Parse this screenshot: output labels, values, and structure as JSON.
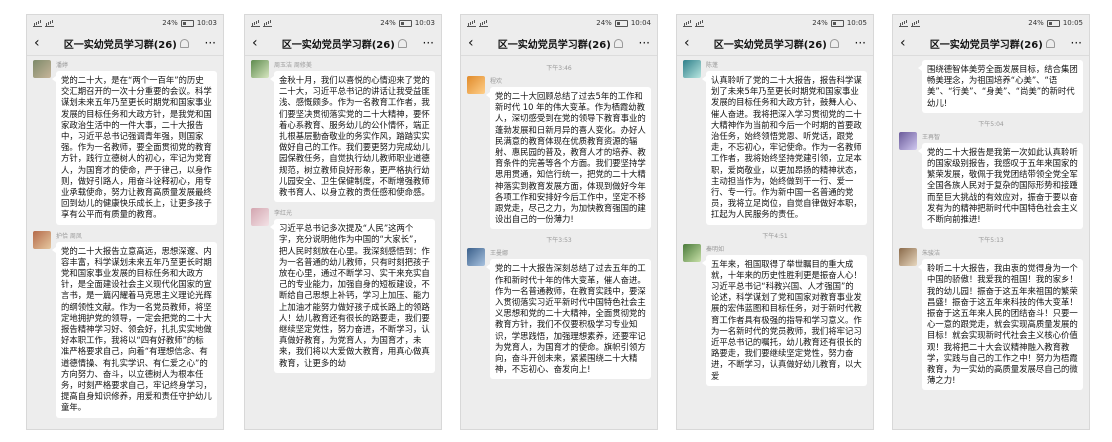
{
  "phones": [
    {
      "status": {
        "time": "10:03",
        "battery": "24%"
      },
      "title": "区一实幼党员学习群(26)",
      "messages": [
        {
          "sender": "潘婷",
          "text": "党的二十大，是在“两个一百年”的历史交汇期召开的一次十分重要的会议。科学谋划未来五年乃至更长时期党和国家事业发展的目标任务和大政方针，是我党和国家政治生活中的一件大事，二十大报告中，习近平总书记强调青年强，则国家强。作为一名教师，要全面贯彻党的教育方针，践行立德树人的初心，牢记为党育人，为国育才的使命，严于律己，以身作则，做好引路人，用奋斗诠释初心，用专业承载使命，努力让教育高质量发展最终回到幼儿的健康快乐成长上，让更多孩子享有公平而有质量的教育。"
        },
        {
          "sender": "护恰 周凤",
          "text": "党的二十大报告立意高远，思想深邃、内容丰富，科学谋划未来五年乃至更长时期党和国家事业发展的目标任务和大政方针，是全面建设社会主义现代化国家的宣言书，是一篇闪耀着马克思主义理论光辉的纲领性文献。作为一名党员教师，将坚定地拥护党的领导，一定会把党的二十大报告精神学习好、领会好，扎扎实实地做好本职工作，我将以“四有好教师”的标准严格要求自己，向着“有理想信念、有道德情操、有扎实学识、有仁爱之心”的方向努力、奋斗，以立德树人为根本任务，时刻严格要求自己，牢记终身学习，提高自身知识修养，用爱和责任守护幼儿童年。"
        }
      ]
    },
    {
      "status": {
        "time": "10:03",
        "battery": "24%"
      },
      "title": "区一实幼党员学习群(26)",
      "messages": [
        {
          "sender": "周玉洁 周修美",
          "text": "金秋十月，我们以喜悦的心情迎来了党的二十大，习近平总书记的讲话让我受益匪浅、感慨颇多。作为一名教育工作者，我们要坚决贯彻落实党的二十大精神，要怀着心系教育、服务幼儿的公仆情怀，端正扎根基层勤奋敬业的务实作风，踏踏实实做好自己的工作。我们要更努力完成幼儿园保教任务，自觉执行幼儿教师职业道德规范，树立教师良好形象，更严格执行幼儿园安全、卫生保健制度，不断增强教师教书育人、以身立教的责任感和使命感。"
        },
        {
          "sender": "李红光",
          "text": "习近平总书记多次提及“人民”这两个字，充分说明他作为中国的“大家长”，把人民时刻放在心里。我深刻感悟到：作为一名普通的幼儿教师，只有时刻把孩子放在心里，通过不断学习、实干来充实自己的专业能力，加强自身的短板建设，不断给自己思想上补钙，学习上加压、能力上加油才能努力做好孩子成长路上的领路人！幼儿教育还有很长的路要走，我们要继续坚定党性，努力奋进，不断学习，认真做好教育，为党育人，为国育才，未来，我们将以大爱做大教育，用真心做真教育，让更多的幼"
        }
      ]
    },
    {
      "status": {
        "time": "10:04",
        "battery": "24%"
      },
      "title": "区一实幼党员学习群(26)",
      "messages": [
        {
          "time": "下午3:46",
          "sender": "程欢",
          "text": "党的二十大回顾总结了过去5年的工作和新时代 10 年的伟大变革。作为栖霞幼教人，深切感受到在党的领导下教育事业的蓬勃发展和日新月异的喜人变化。办好人民满意的教育体现在优质教育资源的辐射、惠民园的普及，教育人才的培养、教育条件的完善等各个方面。我们要坚持学思用贯通，知信行统一，把党的二十大精神落实到教育发展方面，体现到做好今年各项工作和安排好今后工作中，坚定不移跟党走，尽己之力，为加快教育强国的建设出自己的一份薄力!"
        },
        {
          "time": "下午3:53",
          "sender": "王曼娜",
          "text": "党的二十大报告深刻总结了过去五年的工作和新时代十年的伟大变革，催人奋进。作为一名普通教师，在教育实践中，要深入贯彻落实习近平新时代中国特色社会主义思想和党的二十大精神，全面贯彻党的教育方针，我们不仅要积极学习专业知识，学思践悟，加强理想素养，还要牢记为党育人，为国育才的使命。旗帜引领方向，奋斗开创未来，紧紧围绕二十大精神，不忘初心、奋发向上!"
        }
      ]
    },
    {
      "status": {
        "time": "10:05",
        "battery": "24%"
      },
      "title": "区一实幼党员学习群(26)",
      "messages": [
        {
          "sender": "陈蓬",
          "text": "认真聆听了党的二十大报告，报告科学谋划了未来5年乃至更长时期党和国家事业发展的目标任务和大政方针，鼓舞人心、催人奋进。我将把深入学习贯彻党的二十大精神作为当前和今后一个时期的首要政治任务，始终领悟党恩、听党话，跟党走，不忘初心，牢记使命。作为一名教师工作者，我将始终坚持党建引领，立足本职，爱岗敬业，以更加昂扬的精神状态，主动担当作为，始终做到干一行、爱一行、专一行。作为新中国一名普通的党员，我将立足岗位，自觉自律做好本职，扛起为人民服务的责任。"
        },
        {
          "time": "下午4:51",
          "sender": "秦明如",
          "text": "五年来，祖国取得了举世瞩目的重大成就，十年来的历史性胜利更是振奋人心！习近平总书记“科教兴国、人才强国”的论述，科学谋划了党和国家对教育事业发展的宏伟蓝图和目标任务，对于新时代教育工作者具有极强的指导和学习意义。作为一名新时代的党员教师，我们将牢记习近平总书记的嘱托，幼儿教育还有很长的路要走，我们要继续坚定党性，努力奋进，不断学习，认真做好幼儿教育，以大爱"
        }
      ]
    },
    {
      "status": {
        "time": "10:05",
        "battery": "24%"
      },
      "title": "区一实幼党员学习群(26)",
      "messages": [
        {
          "sender": "",
          "text": "围绕德智体美劳全面发展目标，结合集团畅美理念，为祖国培养“心美”、“语美”、“行美”、“身美”、“尚美”的新时代幼儿!"
        },
        {
          "time": "下午5:04",
          "sender": "王再智",
          "text": "党的二十大报告是我第一次如此认真聆听的国家级别报告，我感叹于五年来国家的繁荣发展，敬佩于我党团结带领全党全军全国各族人民对于复杂的国际形势和接踵而至巨大挑战的有效应对，振奋于要以奋发有为的精神把新时代中国特色社会主义不断向前推进!"
        },
        {
          "time": "下午5:13",
          "sender": "朱骏洁",
          "text": "聆听二十大报告，我由衷的觉得身为一个中国的骄傲！我爱我的祖国！我的家乡！我的幼儿园！振奋于这五年来祖国的繁荣昌盛！振奋于这五年来科技的伟大变革！振奋于这五年来人民的团结奋斗！只要一心一意的跟党走，就会实现高质量发展的目标！就会实现新时代社会主义核心价值观！我将把二十大会议精神融入教育教学，实践与自己的工作之中！努力为梧霞教育，为一实幼的高质量发展尽自己的微薄之力!"
        }
      ]
    }
  ]
}
